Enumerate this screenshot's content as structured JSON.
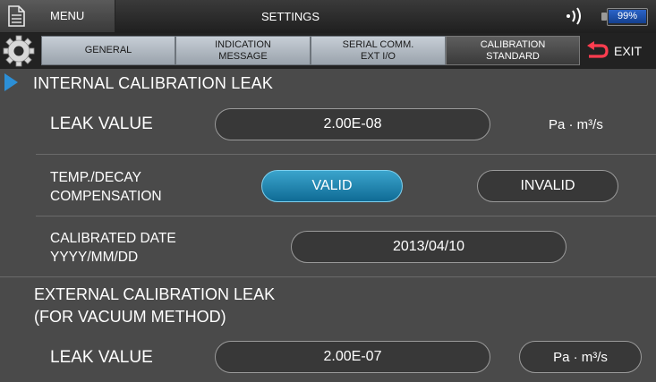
{
  "topbar": {
    "menu_label": "MENU",
    "title": "SETTINGS",
    "battery_percent": 99,
    "battery_label": "99%",
    "signal_icon": "signal-icon",
    "battery_color": "#2b64c8"
  },
  "tabs": [
    {
      "label_line1": "GENERAL",
      "label_line2": "",
      "active": false
    },
    {
      "label_line1": "INDICATION",
      "label_line2": "MESSAGE",
      "active": false
    },
    {
      "label_line1": "SERIAL COMM.",
      "label_line2": "EXT I/O",
      "active": false
    },
    {
      "label_line1": "CALIBRATION",
      "label_line2": "STANDARD",
      "active": true
    }
  ],
  "exit_label": "EXIT",
  "internal": {
    "title": "INTERNAL CALIBRATION LEAK",
    "leak_label": "LEAK VALUE",
    "leak_value": "2.00E-08",
    "leak_unit": "Pa · m³/s",
    "temp_label_line1": "TEMP./DECAY",
    "temp_label_line2": "COMPENSATION",
    "valid_label": "VALID",
    "invalid_label": "INVALID",
    "selected": "VALID",
    "date_label_line1": "CALIBRATED DATE",
    "date_label_line2": "YYYY/MM/DD",
    "date_value": "2013/04/10"
  },
  "external": {
    "title_line1": "EXTERNAL CALIBRATION LEAK",
    "title_line2": "(FOR VACUUM METHOD)",
    "leak_label": "LEAK VALUE",
    "leak_value": "2.00E-07",
    "leak_unit": "Pa · m³/s"
  },
  "colors": {
    "accent": "#1d88b5",
    "background": "#4a4a4a",
    "tab_bg": "#b5bcc4"
  }
}
